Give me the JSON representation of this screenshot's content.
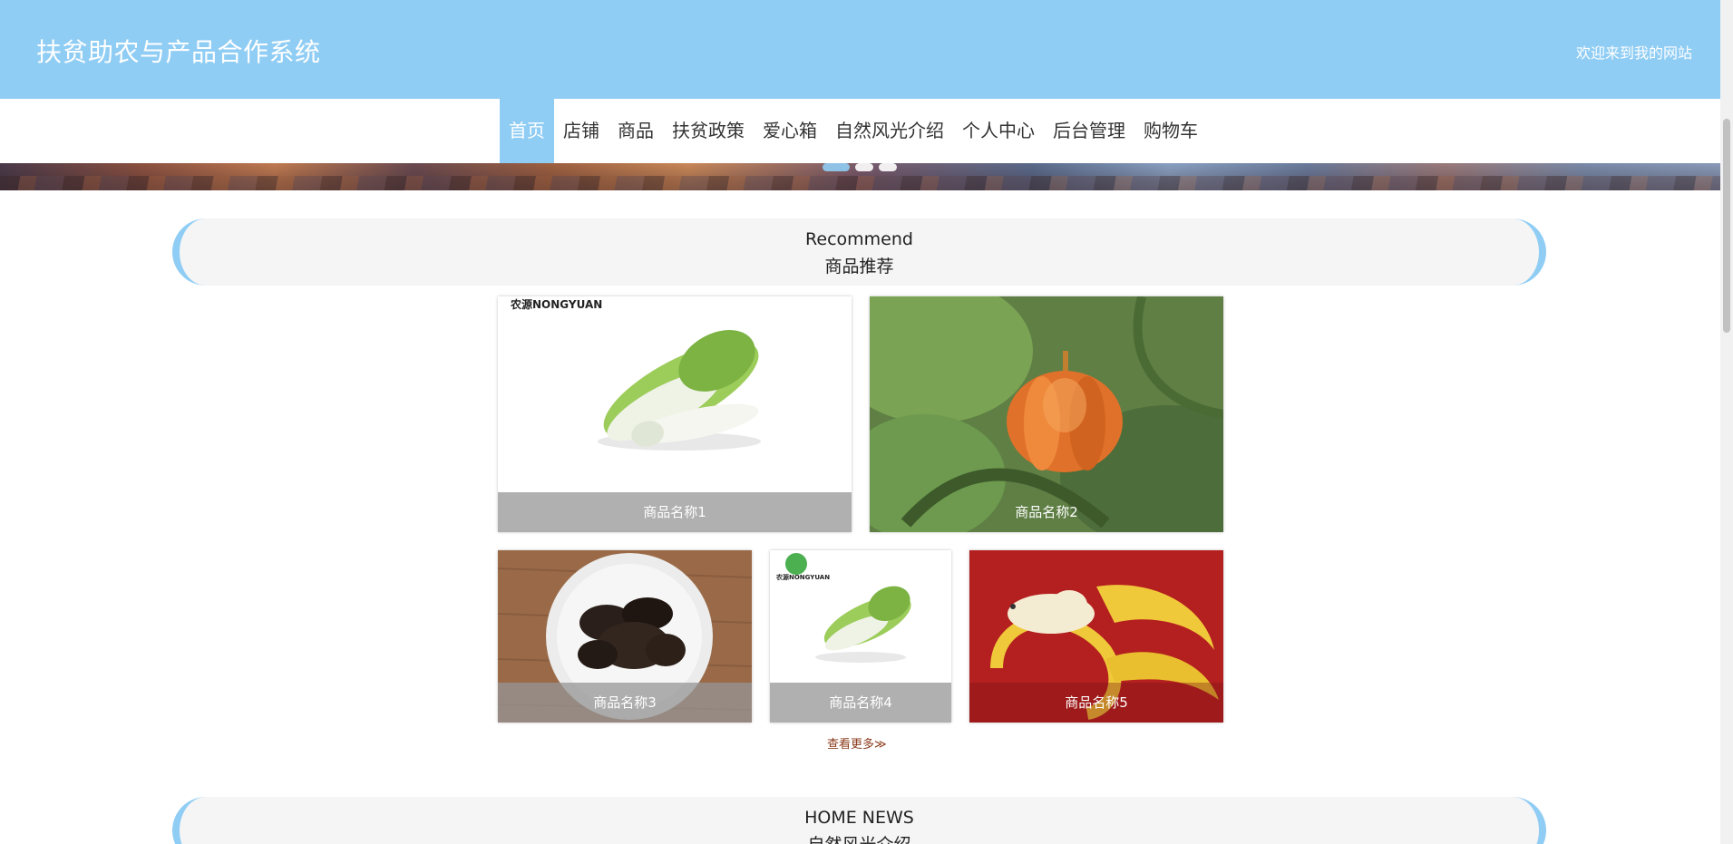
{
  "header": {
    "title": "扶贫助农与产品合作系统",
    "welcome": "欢迎来到我的网站"
  },
  "nav": {
    "items": [
      {
        "label": "首页",
        "active": true
      },
      {
        "label": "店铺"
      },
      {
        "label": "商品"
      },
      {
        "label": "扶贫政策"
      },
      {
        "label": "爱心箱"
      },
      {
        "label": "自然风光介绍"
      },
      {
        "label": "个人中心"
      },
      {
        "label": "后台管理"
      },
      {
        "label": "购物车"
      }
    ]
  },
  "recommend": {
    "title_en": "Recommend",
    "title_cn": "商品推荐",
    "products": [
      {
        "name": "商品名称1",
        "image": "chinese-cabbage-photo",
        "brand_mark": "农源NONGYUAN"
      },
      {
        "name": "商品名称2",
        "image": "pumpkin-photo"
      },
      {
        "name": "商品名称3",
        "image": "black-fungus-photo"
      },
      {
        "name": "商品名称4",
        "image": "chinese-cabbage-photo",
        "brand_mark": "农源NONGYUAN"
      },
      {
        "name": "商品名称5",
        "image": "banana-photo"
      }
    ],
    "more_label": "查看更多≫"
  },
  "news": {
    "title_en": "HOME NEWS",
    "title_cn": "自然风光介绍"
  },
  "colors": {
    "accent": "#90cdf4",
    "caption_bg": "#969696",
    "more_link": "#8a3a1a"
  }
}
